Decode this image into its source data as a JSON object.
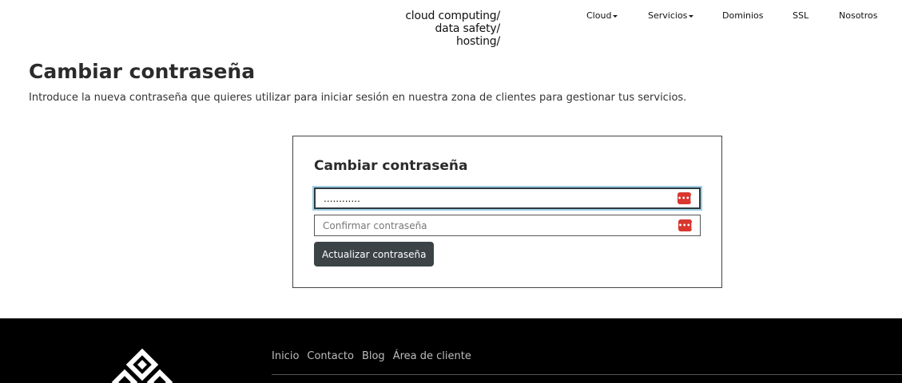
{
  "brand": {
    "line1": "cloud computing/",
    "line2": "data safety/",
    "line3": "hosting/"
  },
  "nav": {
    "items": [
      {
        "label": "Cloud",
        "dropdown": true
      },
      {
        "label": "Servicios",
        "dropdown": true
      },
      {
        "label": "Dominios",
        "dropdown": false
      },
      {
        "label": "SSL",
        "dropdown": false
      },
      {
        "label": "Nosotros",
        "dropdown": false
      }
    ]
  },
  "page": {
    "title": "Cambiar contraseña",
    "description": "Introduce la nueva contraseña que quieres utilizar para iniciar sesión en nuestra zona de clientes para gestionar tus servicios."
  },
  "form": {
    "title": "Cambiar contraseña",
    "new_password_value": "............",
    "confirm_placeholder": "Confirmar contraseña",
    "submit_label": "Actualizar contraseña",
    "password_manager_icon": "password-manager-icon",
    "icon_glyph": "•••|"
  },
  "footer": {
    "links": [
      "Inicio",
      "Contacto",
      "Blog",
      "Área de cliente"
    ]
  },
  "colors": {
    "button_bg": "#3b4347",
    "focus_ring": "#9ed0e6",
    "icon_red": "#d9362f",
    "footer_bg": "#000000"
  }
}
